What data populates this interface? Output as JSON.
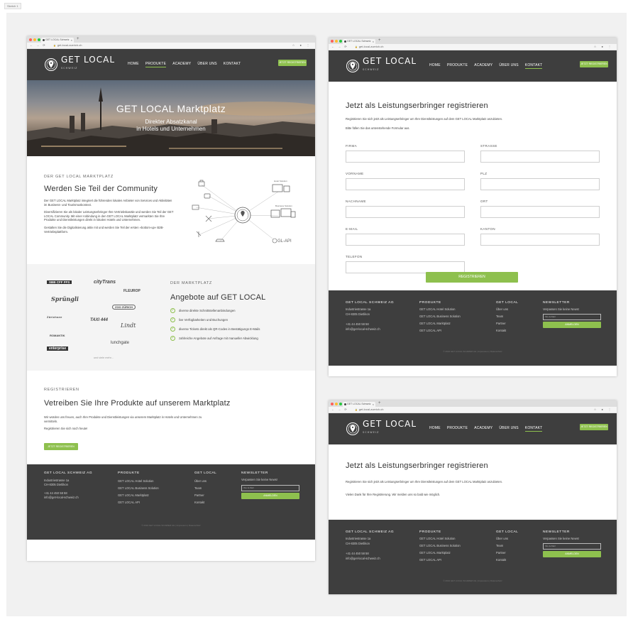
{
  "frame_label": "Sketch 1",
  "browser": {
    "tab_title": "GET LOCAL Schweiz",
    "tab_close": "×",
    "new_tab": "+",
    "url": "get-local-zuerich.ch",
    "nav_glyphs": "← → ⟳",
    "ext_glyphs": "☆ ● ⋮"
  },
  "header": {
    "logo_text": "GET LOCAL",
    "logo_sub": "SCHWEIZ",
    "menu": [
      "HOME",
      "PRODUKTE",
      "ACADEMY",
      "ÜBER UNS",
      "KONTAKT"
    ],
    "cta": "JETZT REGISTRIEREN"
  },
  "hero": {
    "title": "GET LOCAL Marktplatz",
    "subtitle_1": "Direkter Absatzkanal",
    "subtitle_2": "in Hotels und Unternehmen"
  },
  "community": {
    "kicker": "DER GET LOCAL MARKTPLATZ",
    "title": "Werden Sie Teil der Community",
    "p1": "Der GET LOCAL Marktplatz integriert die führenden lokalen Anbieter von Services und Aktivitäten im Business- und Tourismuskontext.",
    "p2": "Diversifizieren Sie als lokaler Leistungserbringer Ihre Vertriebskanäle und werden Sie Teil der GET LOCAL Community. Mit einer Anbindung in den GET LOCAL Marktplatz vermarkten Sie Ihre Produkte und Dienstleistungen direkt in lokalen Hotels und Unternehmen.",
    "p3": "Gestalten Sie die Digitalisierung aktiv mit und werden Sie Teil der ersten «bottom-up» B2B-Vertriebsplattform.",
    "diagram_hotel": "Hotel Solution",
    "diagram_business": "Business Solution",
    "diagram_api": "GL-API"
  },
  "offers": {
    "kicker": "DER MARKTPLATZ",
    "title": "Angebote auf GET LOCAL",
    "items": [
      "diverse direkte Schnittstellenanbindungen",
      "live Verfügbarkeiten und Buchungen",
      "diverse Tickets direkt als QR-Codes in Bestätigungs E-Mails",
      "zahlreiche Angebote auf Anfrage mit manueller Abwicklung"
    ],
    "partners": [
      "SBB CFF FFS",
      "cityTrans",
      "FLEUROP",
      "Sprüngli",
      "ZOO ZÜRICH",
      "Zürichsee",
      "TAXI 444",
      "Lindt",
      "ROMANTIK",
      "enterprise",
      "lunchgate"
    ],
    "more": "und viele mehr..."
  },
  "register_sec": {
    "kicker": "REGISTRIEREN",
    "title": "Vetreiben Sie Ihre Produkte auf unserem Marktplatz",
    "p1": "Wir würden uns freuen, auch Ihre Produkte und Dienstleistungen via unserem Marktplatz in Hotels und Unternehmen zu vermitteln.",
    "p2": "Registrieren Sie sich noch heute!",
    "cta": "JETZT REGISTRIEREN"
  },
  "form": {
    "title": "Jetzt als Leistungserbringer registrieren",
    "intro_1": "Registrieren Sie sich jetzt als Leistungserbringer um Ihre Dienstleistungen auf dem GET LOCAL Marktplatz anzubieten.",
    "intro_2": "Bitte füllen Sie das untenstehende Formular aus.",
    "left_labels": [
      "FIRMA",
      "VORNAME",
      "NACHNAME",
      "E-MAIL",
      "TELEFON"
    ],
    "right_labels": [
      "STRASSE",
      "PLZ",
      "ORT",
      "KANTON"
    ],
    "submit": "REGISTRIEREN"
  },
  "thanks": {
    "title": "Jetzt als Leistungserbringer registrieren",
    "intro": "Registrieren Sie sich jetzt als Leistungserbringer um Ihre Dienstleistungen auf dem GET LOCAL Marktplatz anzubieten.",
    "message": "Vielen Dank für Ihre Registrierung. Wir melden uns so bald wie möglich."
  },
  "footer": {
    "company": {
      "title": "GET LOCAL SCHWEIZ AG",
      "lines": [
        "Industriestrasse 1a",
        "CH-8305 Dietlikon",
        "",
        "+41 44 450 58 58",
        "info@get-local-schweiz.ch"
      ]
    },
    "products": {
      "title": "PRODUKTE",
      "lines": [
        "GET LOCAL Hotel Solution",
        "GET LOCAL Business Solution",
        "GET LOCAL Marktplatz",
        "GET LOCAL API"
      ]
    },
    "getlocal": {
      "title": "GET LOCAL",
      "lines": [
        "Über uns",
        "Team",
        "Partner",
        "Kontakt"
      ]
    },
    "newsletter": {
      "title": "NEWSLETTER",
      "tagline": "Verpassen Sie keine News!",
      "placeholder": "Ihre E-Mail",
      "button": "ANMELDEN"
    },
    "copyright": "© 2024 GET LOCAL SCHWEIZ AG  |  Impressum  |  Datenschutz"
  },
  "colors": {
    "accent": "#8ec04e",
    "header_bg": "#3e3e3e",
    "canvas": "#f1f1f1"
  }
}
